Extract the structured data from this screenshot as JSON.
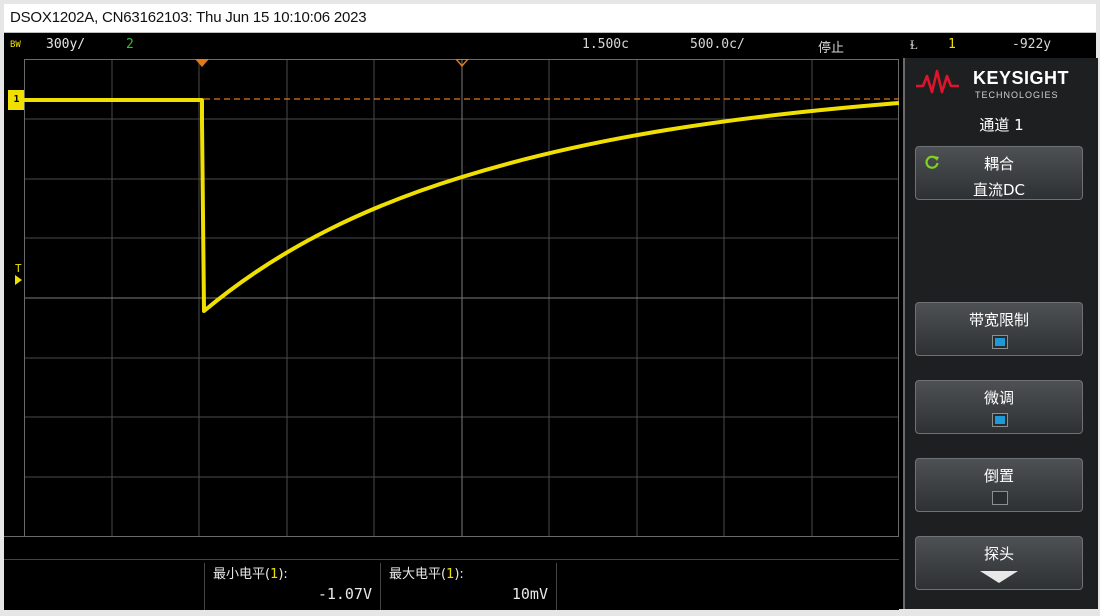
{
  "window": {
    "title": "DSOX1202A, CN63162103: Thu Jun 15 10:10:06 2023"
  },
  "status_bar": {
    "bw_tag": "BW",
    "ch1_scale": "300у/",
    "ch2_indicator": "2",
    "time_offset": "1.500с",
    "time_scale": "500.0с/",
    "run_state": "停止",
    "trigger_icon": "Ɫ",
    "trigger_source": "1",
    "trigger_level": "-922у"
  },
  "scope": {
    "channel_marker": "1",
    "trigger_marker": "T",
    "colors": {
      "channel1": "#f0e000",
      "trigger_line": "#e07a1a",
      "grid": "#5a5a5a",
      "background": "#000000"
    }
  },
  "measurements": [
    {
      "label_prefix": "最小电平(",
      "channel": "1",
      "label_suffix": "):",
      "value": "-1.07V"
    },
    {
      "label_prefix": "最大电平(",
      "channel": "1",
      "label_suffix": "):",
      "value": "10mV"
    }
  ],
  "side_panel": {
    "brand": "KEYSIGHT",
    "brand_sub": "TECHNOLOGIES",
    "menu_title": "通道 1",
    "buttons": [
      {
        "label": "耦合",
        "value": "直流DC",
        "icon": "cycle-icon"
      },
      {
        "label": "带宽限制",
        "checked": true
      },
      {
        "label": "微调",
        "checked": true
      },
      {
        "label": "倒置",
        "checked": false
      },
      {
        "label": "探头",
        "icon": "down-arrow-icon"
      }
    ]
  }
}
